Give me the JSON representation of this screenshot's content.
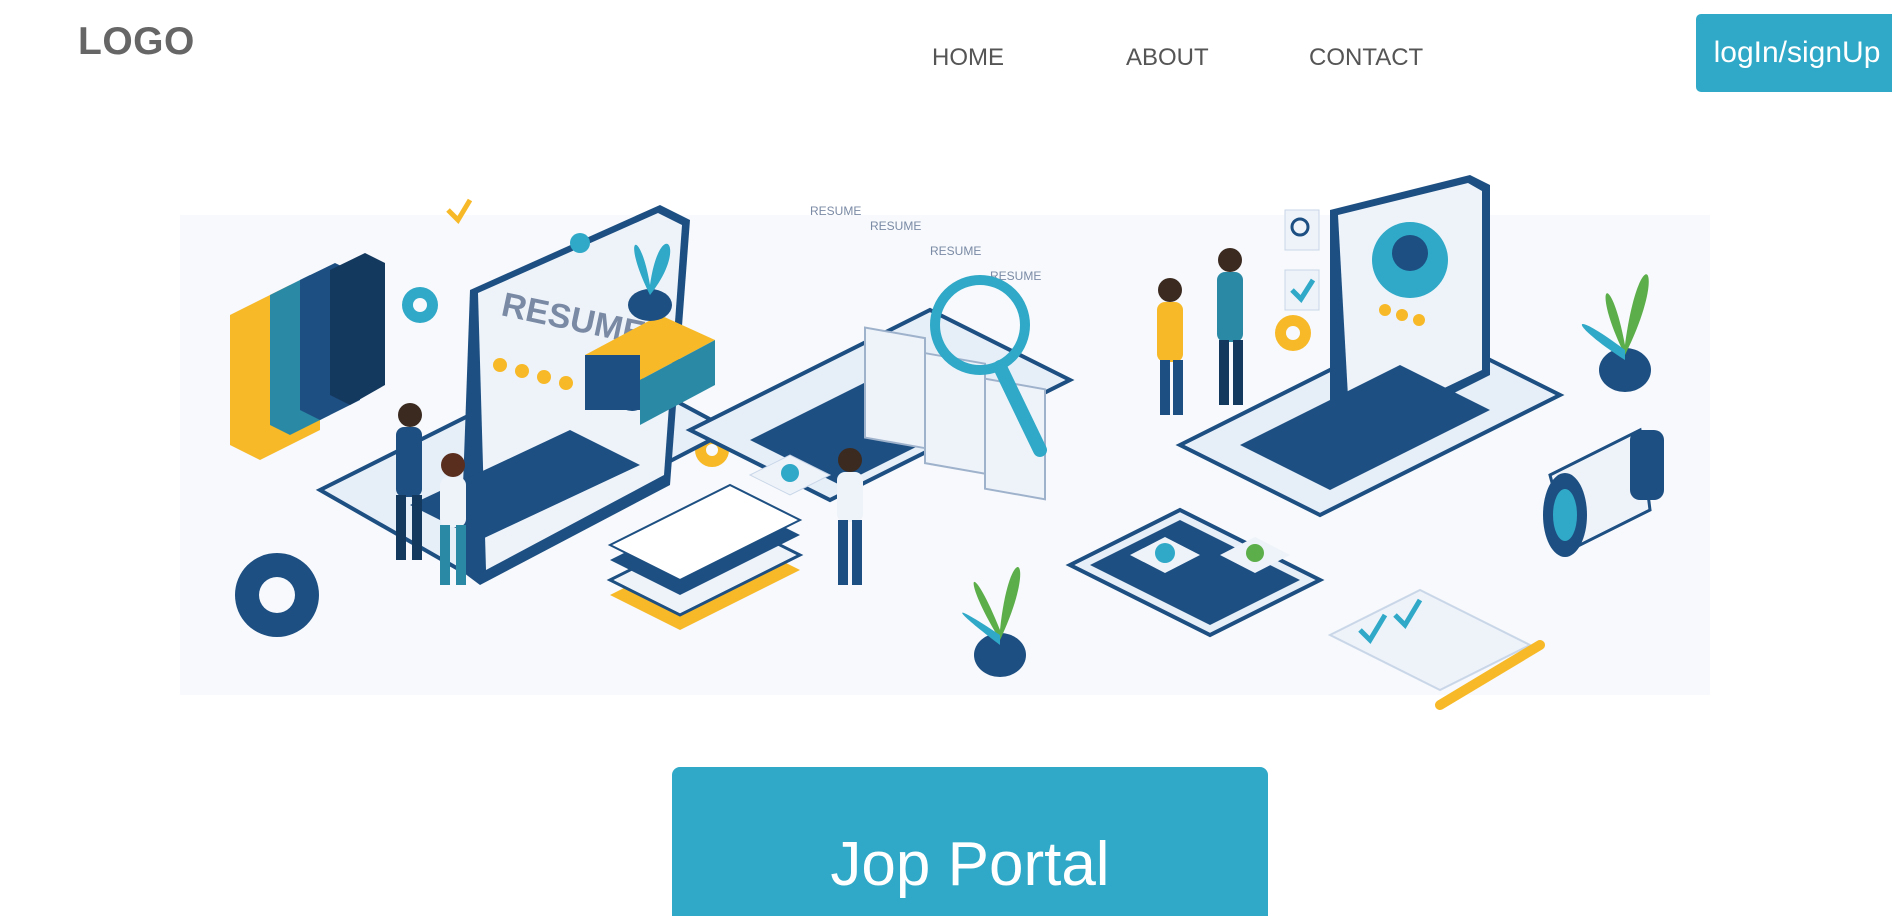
{
  "header": {
    "logo": "LOGO",
    "nav": {
      "home": "HOME",
      "about": "ABOUT",
      "contact": "CONTACT"
    },
    "auth_button": "logIn/signUp"
  },
  "hero": {
    "illustration": "job-search-isometric-illustration",
    "resume_label": "RESUME",
    "doc_labels": [
      "RESUME",
      "RESUME",
      "RESUME",
      "RESUME"
    ],
    "colors": {
      "navy": "#1d4f82",
      "teal": "#2fa9c7",
      "yellow": "#f7b928",
      "light": "#e6eef8"
    }
  },
  "cta": {
    "title": "Jop Portal"
  },
  "colors": {
    "accent": "#2fa9c7",
    "text": "#555555",
    "logo": "#666666"
  }
}
